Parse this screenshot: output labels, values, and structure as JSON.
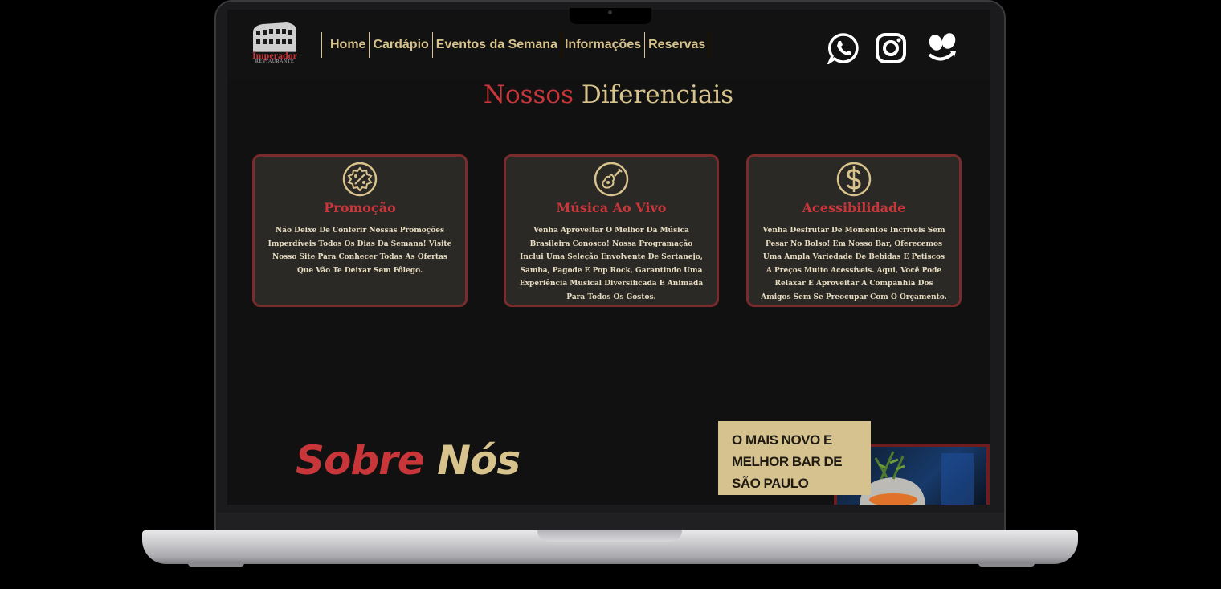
{
  "brand": {
    "logo_name": "Imperador",
    "logo_sub": "RESTAURANTE"
  },
  "nav": {
    "items": [
      {
        "label": "Home"
      },
      {
        "label": "Cardápio"
      },
      {
        "label": "Eventos da Semana"
      },
      {
        "label": "Informações"
      },
      {
        "label": "Reservas"
      }
    ]
  },
  "social": {
    "icons": [
      "whatsapp-icon",
      "instagram-icon",
      "foursquare-icon"
    ]
  },
  "differentials": {
    "title_part1": "Nossos",
    "title_part2": "Diferenciais",
    "cards": [
      {
        "icon": "discount-badge-icon",
        "title": "Promoção",
        "text": "Não Deixe De Conferir Nossas Promoções Imperdíveis Todos Os Dias Da Semana! Visite Nosso Site Para Conhecer Todas As Ofertas Que Vão Te Deixar Sem Fôlego."
      },
      {
        "icon": "guitar-icon",
        "title": "Música Ao Vivo",
        "text": "Venha Aproveitar O Melhor Da Música Brasileira Conosco! Nossa Programação Inclui Uma Seleção Envolvente De Sertanejo, Samba, Pagode E Pop Rock, Garantindo Uma Experiência Musical Diversificada E Animada Para Todos Os Gostos."
      },
      {
        "icon": "dollar-icon",
        "title": "Acessibilidade",
        "text": "Venha Desfrutar De Momentos Incríveis Sem Pesar No Bolso! Em Nosso Bar, Oferecemos Uma Ampla Variedade De Bebidas E Petiscos A Preços Muito Acessíveis. Aqui, Você Pode Relaxar E Aproveitar A Companhia Dos Amigos Sem Se Preocupar Com O Orçamento."
      }
    ]
  },
  "about": {
    "title_part1": "Sobre",
    "title_part2": "Nós",
    "promo_lines": [
      "O MAIS NOVO E",
      "MELHOR BAR DE",
      "SÃO PAULO"
    ]
  },
  "colors": {
    "accent_red": "#c8363a",
    "accent_gold": "#d8c38c",
    "card_bg": "#2b2926",
    "card_border": "#7a2b2c"
  }
}
